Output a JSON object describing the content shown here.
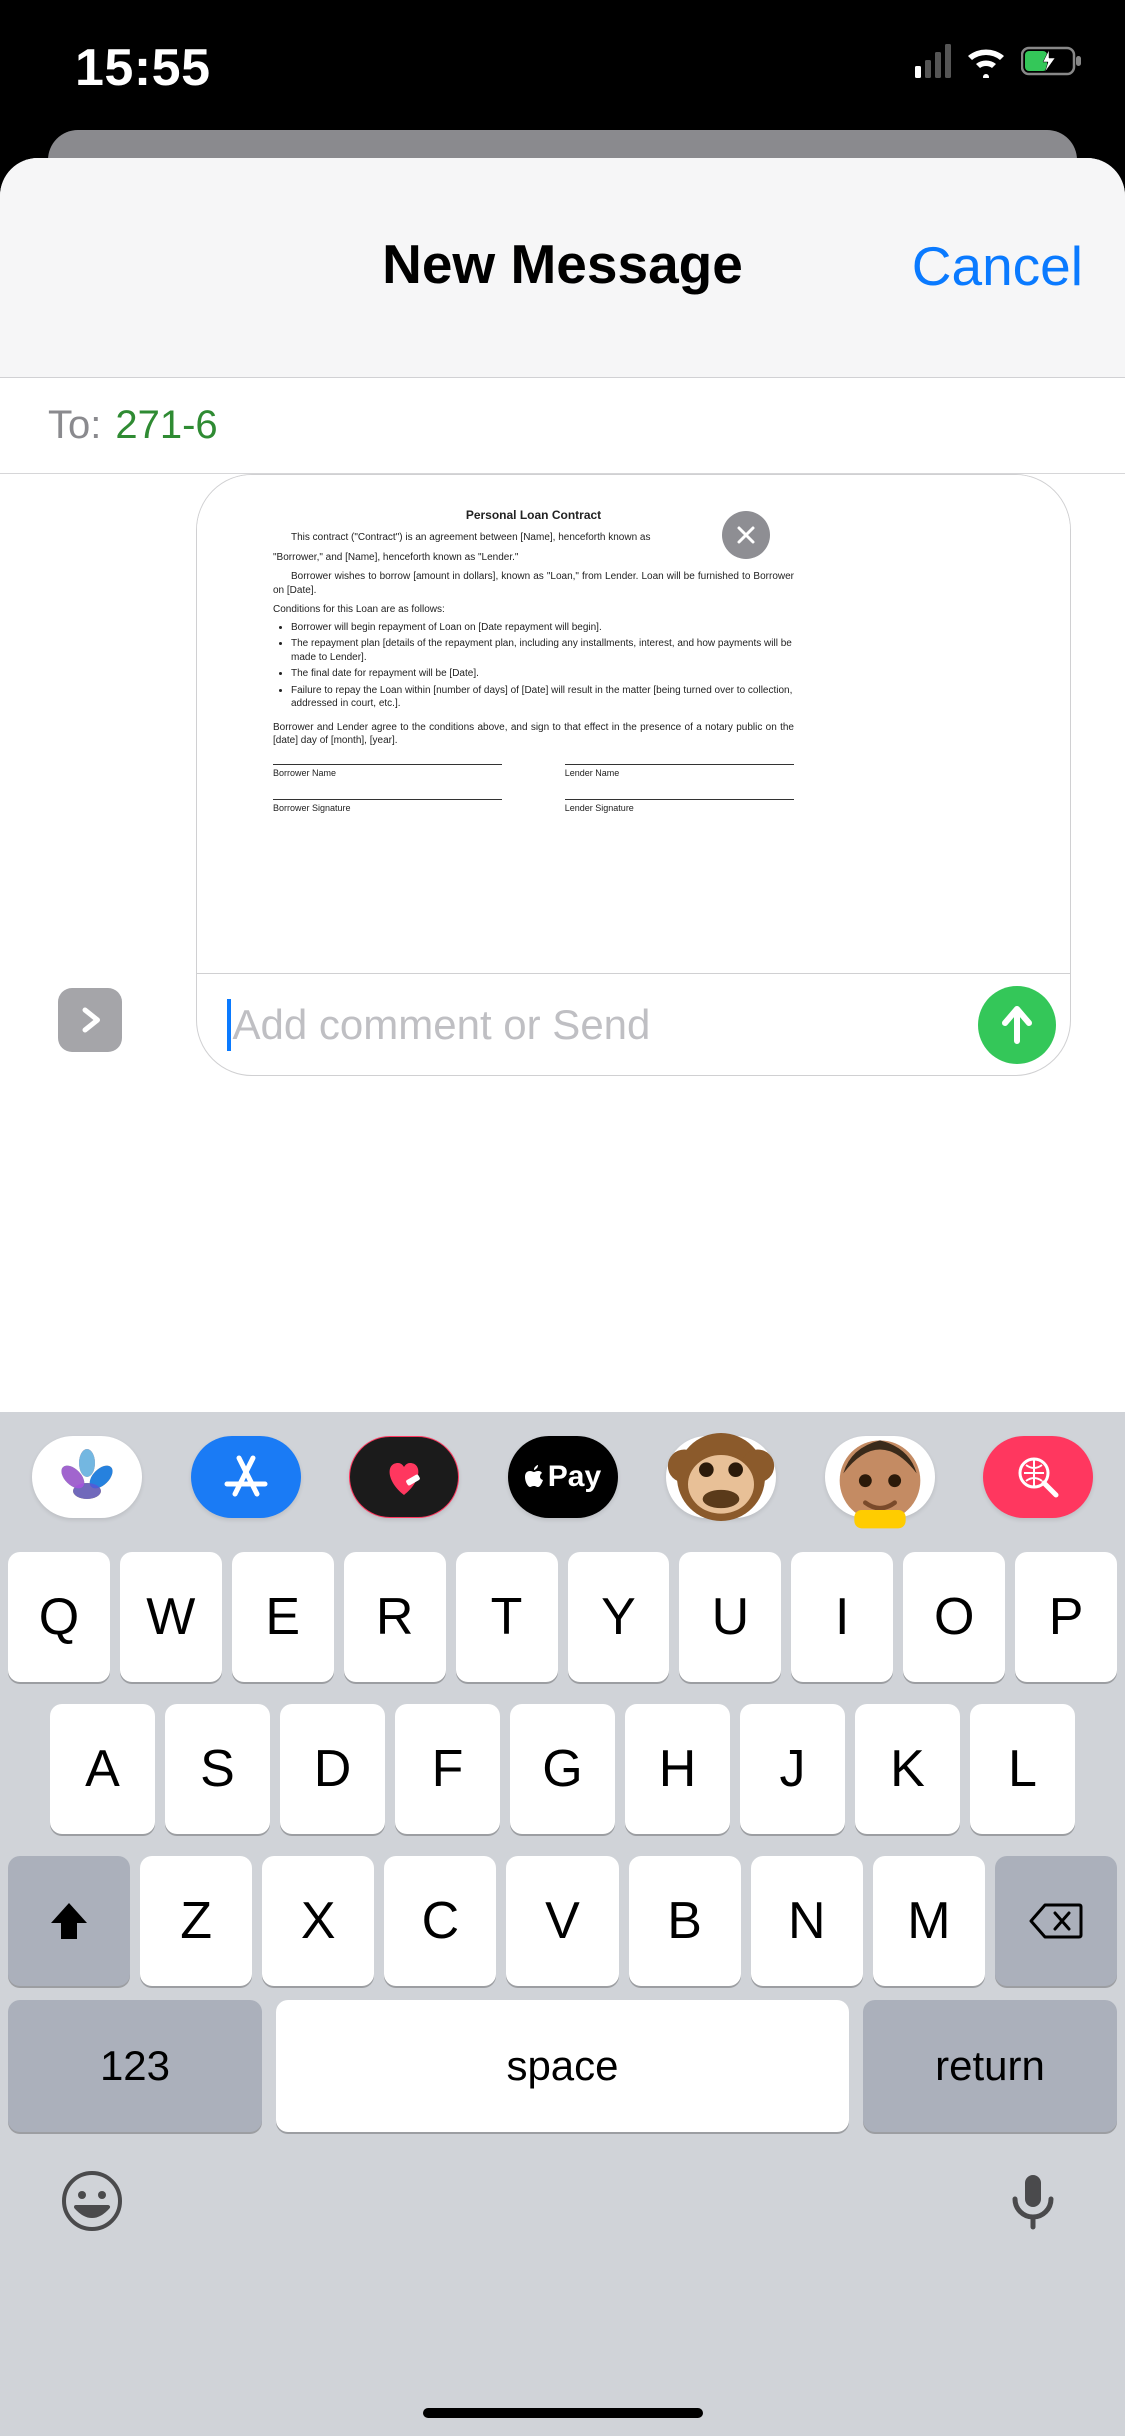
{
  "status_bar": {
    "time": "15:55"
  },
  "compose": {
    "title": "New Message",
    "cancel": "Cancel",
    "to_label": "To:",
    "to_value": "271-6"
  },
  "input": {
    "placeholder": "Add comment or Send"
  },
  "attachment": {
    "doc_title": "Personal Loan Contract",
    "para1a": "This contract (\"Contract\") is an agreement between [Name], henceforth known as",
    "para1b": "\"Borrower,\" and [Name], henceforth known as \"Lender.\"",
    "para2": "Borrower wishes to borrow [amount in dollars], known as \"Loan,\" from Lender. Loan will be furnished to Borrower on [Date].",
    "conditions_label": "Conditions for this Loan are as follows:",
    "bullets": [
      "Borrower will begin repayment of Loan on [Date repayment will begin].",
      "The repayment plan [details of the repayment plan, including any installments, interest, and how payments will be made to Lender].",
      "The final date for repayment will be [Date].",
      "Failure to repay the Loan within [number of days] of [Date] will result in the matter [being turned over to collection, addressed in court, etc.]."
    ],
    "agree_text": "Borrower and Lender agree to the conditions above, and sign to that effect in the presence of a notary public on the [date] day of [month], [year].",
    "borrower_name": "Borrower Name",
    "lender_name": "Lender Name",
    "borrower_sig": "Borrower Signature",
    "lender_sig": "Lender Signature"
  },
  "app_strip": {
    "apple_pay": "Pay"
  },
  "keyboard": {
    "row1": [
      "Q",
      "W",
      "E",
      "R",
      "T",
      "Y",
      "U",
      "I",
      "O",
      "P"
    ],
    "row2": [
      "A",
      "S",
      "D",
      "F",
      "G",
      "H",
      "J",
      "K",
      "L"
    ],
    "row3": [
      "Z",
      "X",
      "C",
      "V",
      "B",
      "N",
      "M"
    ],
    "key_123": "123",
    "key_space": "space",
    "key_return": "return"
  }
}
